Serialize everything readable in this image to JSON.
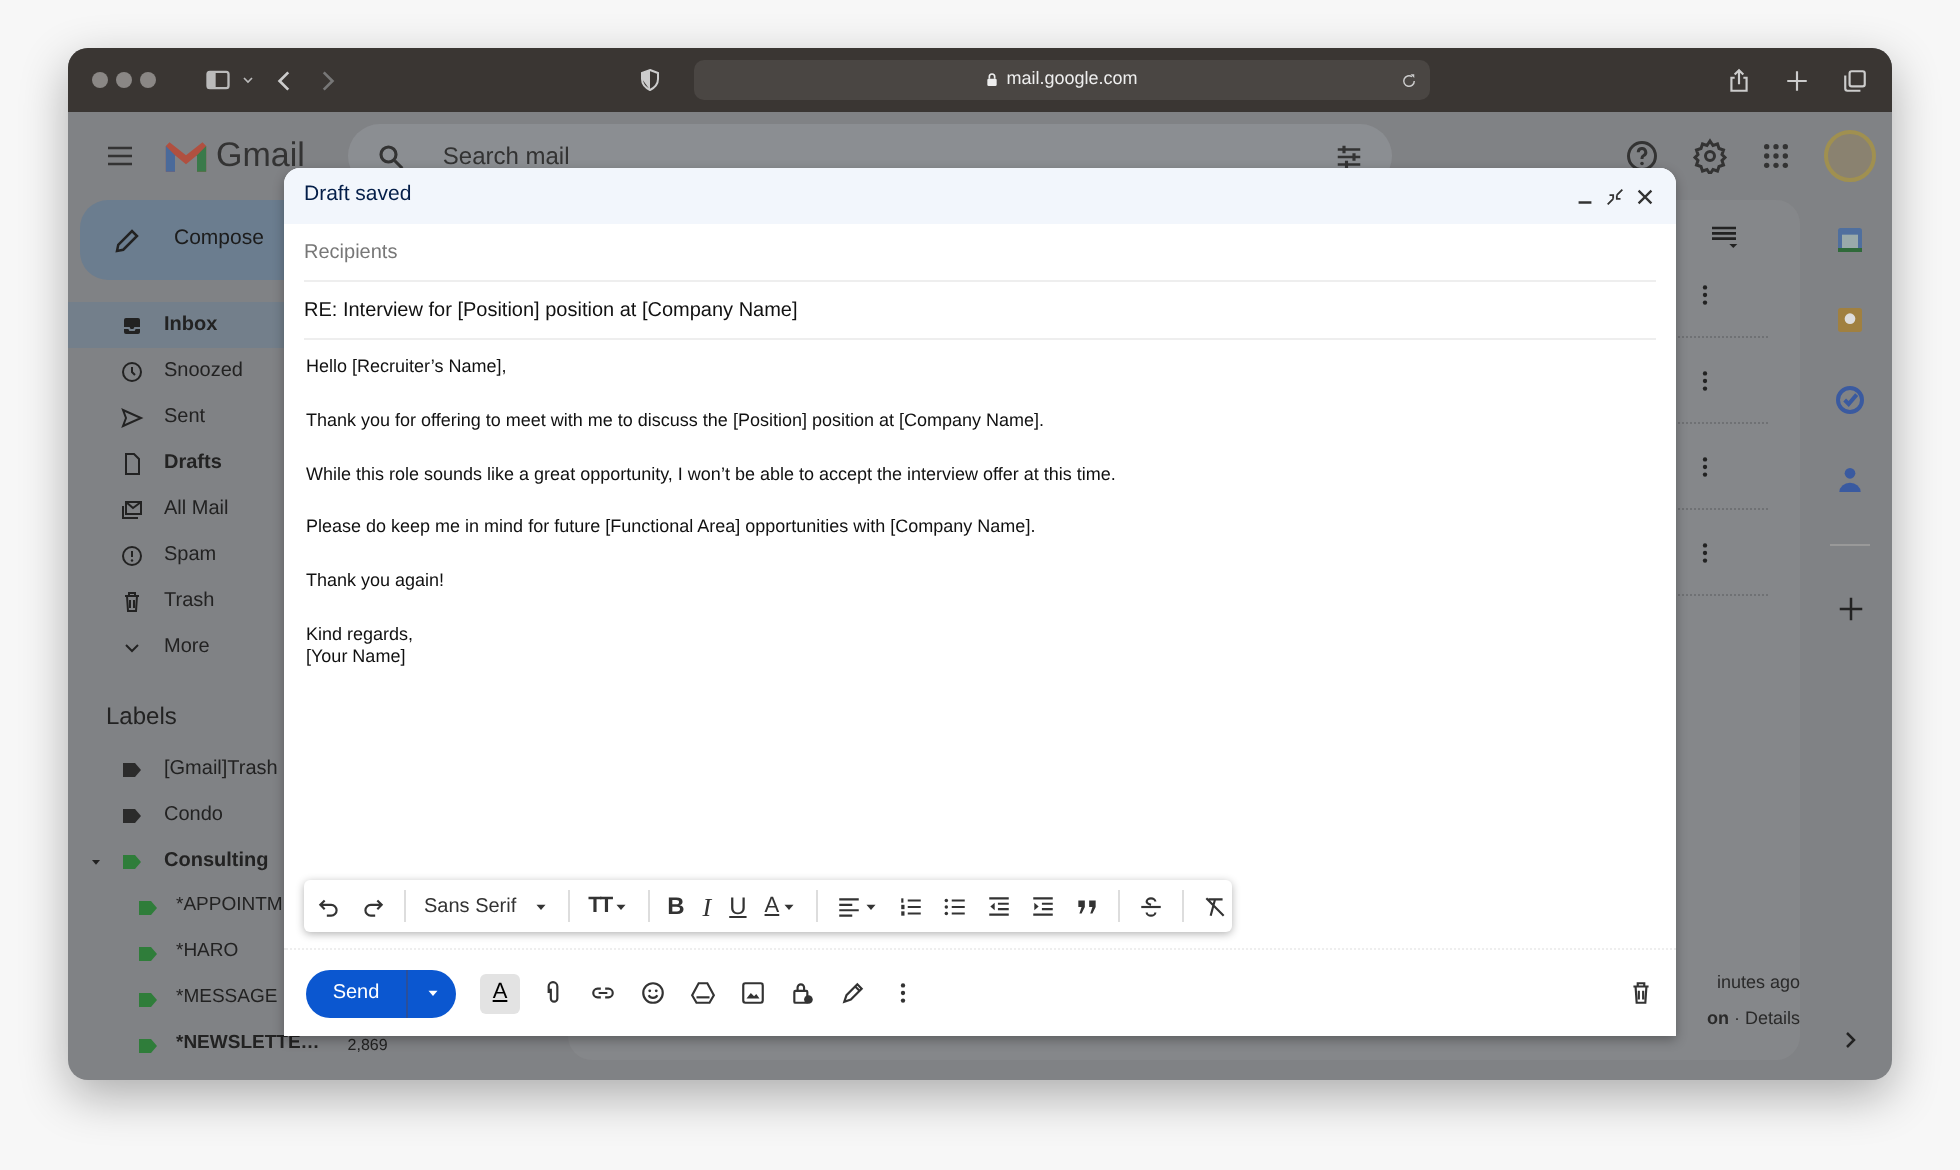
{
  "browser": {
    "url": "mail.google.com"
  },
  "gmail": {
    "product_name": "Gmail",
    "search": {
      "placeholder": "Search mail"
    },
    "compose_label": "Compose",
    "folders": [
      {
        "label": "Inbox",
        "selected": true,
        "unread": true
      },
      {
        "label": "Snoozed",
        "selected": false,
        "unread": false
      },
      {
        "label": "Sent",
        "selected": false,
        "unread": false
      },
      {
        "label": "Drafts",
        "selected": false,
        "unread": true
      },
      {
        "label": "All Mail",
        "selected": false,
        "unread": false
      },
      {
        "label": "Spam",
        "selected": false,
        "unread": false
      },
      {
        "label": "Trash",
        "selected": false,
        "unread": false
      },
      {
        "label": "More",
        "selected": false,
        "unread": false
      }
    ],
    "labels_heading": "Labels",
    "labels": [
      {
        "name": "[Gmail]Trash",
        "color": "#2b2b2b",
        "unread": false
      },
      {
        "name": "Condo",
        "color": "#2b2b2b",
        "unread": false
      },
      {
        "name": "Consulting",
        "color": "#2f7d3a",
        "unread": true,
        "expanded": true,
        "children": [
          {
            "name": "*APPOINTM",
            "color": "#2f7d3a",
            "unread": false
          },
          {
            "name": "*HARO",
            "color": "#2f7d3a",
            "unread": false
          },
          {
            "name": "*MESSAGE",
            "color": "#2f7d3a",
            "unread": false
          },
          {
            "name": "*NEWSLETTE…",
            "color": "#2f7d3a",
            "unread": true,
            "count": "2,869"
          }
        ]
      }
    ],
    "activity": {
      "time": "inutes ago",
      "details": "**on** · Details"
    }
  },
  "compose": {
    "status": "Draft saved",
    "recipients": {
      "placeholder": "Recipients"
    },
    "subject": "RE: Interview for [Position] position at [Company Name]",
    "body": [
      "Hello [Recruiter’s Name],",
      "Thank you for offering to meet with me to discuss the [Position] position at [Company Name].",
      "While this role sounds like a great opportunity, I won’t be able to accept the interview offer at this time.",
      "Please do keep me in mind for future [Functional Area] opportunities with [Company Name].",
      "Thank you again!",
      "Kind regards,\n[Your Name]"
    ],
    "format_toolbar": {
      "font": "Sans Serif",
      "size_key": "TT",
      "bold_key": "B",
      "italic_key": "I",
      "underline_key": "U",
      "color_key": "A"
    },
    "formatting_key": "A",
    "send_label": "Send"
  }
}
